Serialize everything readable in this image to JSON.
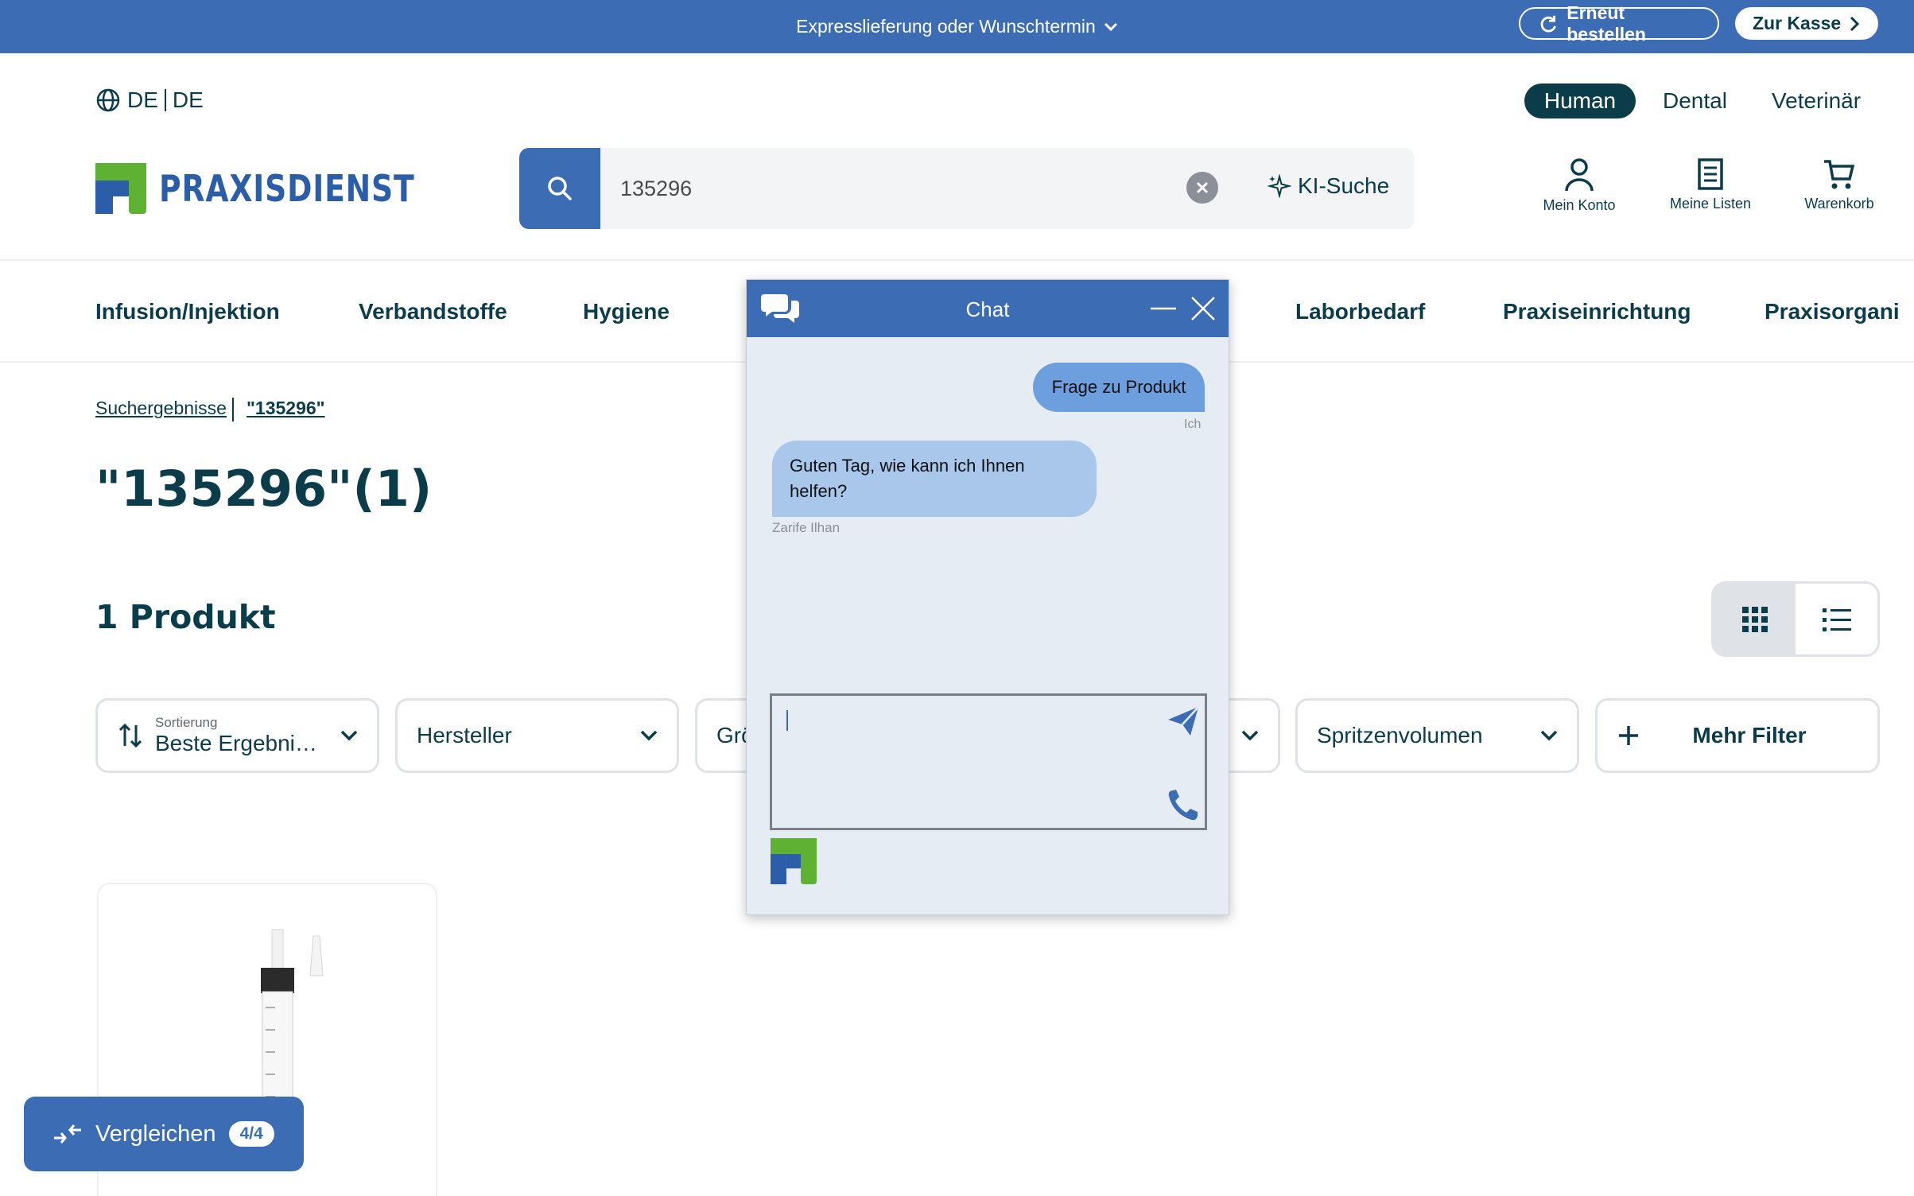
{
  "topbar": {
    "delivery_text": "Expresslieferung oder Wunschtermin",
    "reorder_label": "Erneut bestellen",
    "checkout_label": "Zur Kasse"
  },
  "header": {
    "lang_a": "DE",
    "lang_b": "DE",
    "segments": {
      "human": "Human",
      "dental": "Dental",
      "vet": "Veterinär"
    },
    "logo_text": "PRAXISDIENST",
    "search": {
      "value": "135296",
      "ki_label": "KI-Suche"
    },
    "account_label": "Mein Konto",
    "lists_label": "Meine Listen",
    "cart_label": "Warenkorb"
  },
  "categories": [
    "Infusion/Injektion",
    "Verbandstoffe",
    "Hygiene",
    "Laborbedarf",
    "Praxiseinrichtung",
    "Praxisorgani"
  ],
  "breadcrumb": {
    "root": "Suchergebnisse",
    "current": "\"135296\""
  },
  "page_title": "\"135296\"(1)",
  "product_count": "1 Produkt",
  "filters": {
    "sort_small": "Sortierung",
    "sort_value": "Beste Ergebni…",
    "hersteller": "Hersteller",
    "groesse": "Grö",
    "spritzen": "Spritzenvolumen",
    "more": "Mehr Filter"
  },
  "compare": {
    "label": "Vergleichen",
    "badge": "4/4"
  },
  "chat": {
    "title": "Chat",
    "me_message": "Frage zu Produkt",
    "me_label": "Ich",
    "agent_message": "Guten Tag, wie kann ich Ihnen helfen?",
    "agent_label": "Zarife Ilhan"
  },
  "colors": {
    "brand_blue": "#3c6db4",
    "dark_teal": "#0b3c49",
    "logo_green": "#5fb133"
  }
}
